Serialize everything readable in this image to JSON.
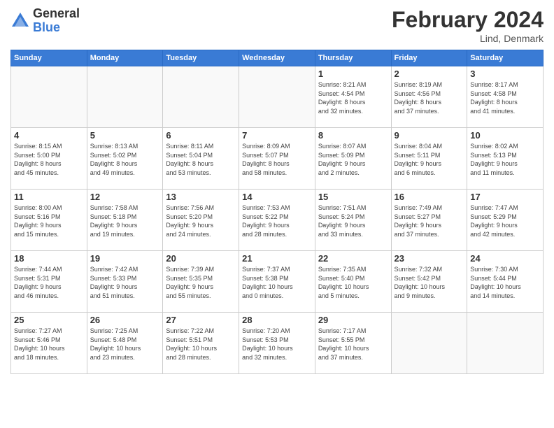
{
  "logo": {
    "general": "General",
    "blue": "Blue"
  },
  "header": {
    "title": "February 2024",
    "location": "Lind, Denmark"
  },
  "weekdays": [
    "Sunday",
    "Monday",
    "Tuesday",
    "Wednesday",
    "Thursday",
    "Friday",
    "Saturday"
  ],
  "weeks": [
    [
      {
        "day": "",
        "info": ""
      },
      {
        "day": "",
        "info": ""
      },
      {
        "day": "",
        "info": ""
      },
      {
        "day": "",
        "info": ""
      },
      {
        "day": "1",
        "info": "Sunrise: 8:21 AM\nSunset: 4:54 PM\nDaylight: 8 hours\nand 32 minutes."
      },
      {
        "day": "2",
        "info": "Sunrise: 8:19 AM\nSunset: 4:56 PM\nDaylight: 8 hours\nand 37 minutes."
      },
      {
        "day": "3",
        "info": "Sunrise: 8:17 AM\nSunset: 4:58 PM\nDaylight: 8 hours\nand 41 minutes."
      }
    ],
    [
      {
        "day": "4",
        "info": "Sunrise: 8:15 AM\nSunset: 5:00 PM\nDaylight: 8 hours\nand 45 minutes."
      },
      {
        "day": "5",
        "info": "Sunrise: 8:13 AM\nSunset: 5:02 PM\nDaylight: 8 hours\nand 49 minutes."
      },
      {
        "day": "6",
        "info": "Sunrise: 8:11 AM\nSunset: 5:04 PM\nDaylight: 8 hours\nand 53 minutes."
      },
      {
        "day": "7",
        "info": "Sunrise: 8:09 AM\nSunset: 5:07 PM\nDaylight: 8 hours\nand 58 minutes."
      },
      {
        "day": "8",
        "info": "Sunrise: 8:07 AM\nSunset: 5:09 PM\nDaylight: 9 hours\nand 2 minutes."
      },
      {
        "day": "9",
        "info": "Sunrise: 8:04 AM\nSunset: 5:11 PM\nDaylight: 9 hours\nand 6 minutes."
      },
      {
        "day": "10",
        "info": "Sunrise: 8:02 AM\nSunset: 5:13 PM\nDaylight: 9 hours\nand 11 minutes."
      }
    ],
    [
      {
        "day": "11",
        "info": "Sunrise: 8:00 AM\nSunset: 5:16 PM\nDaylight: 9 hours\nand 15 minutes."
      },
      {
        "day": "12",
        "info": "Sunrise: 7:58 AM\nSunset: 5:18 PM\nDaylight: 9 hours\nand 19 minutes."
      },
      {
        "day": "13",
        "info": "Sunrise: 7:56 AM\nSunset: 5:20 PM\nDaylight: 9 hours\nand 24 minutes."
      },
      {
        "day": "14",
        "info": "Sunrise: 7:53 AM\nSunset: 5:22 PM\nDaylight: 9 hours\nand 28 minutes."
      },
      {
        "day": "15",
        "info": "Sunrise: 7:51 AM\nSunset: 5:24 PM\nDaylight: 9 hours\nand 33 minutes."
      },
      {
        "day": "16",
        "info": "Sunrise: 7:49 AM\nSunset: 5:27 PM\nDaylight: 9 hours\nand 37 minutes."
      },
      {
        "day": "17",
        "info": "Sunrise: 7:47 AM\nSunset: 5:29 PM\nDaylight: 9 hours\nand 42 minutes."
      }
    ],
    [
      {
        "day": "18",
        "info": "Sunrise: 7:44 AM\nSunset: 5:31 PM\nDaylight: 9 hours\nand 46 minutes."
      },
      {
        "day": "19",
        "info": "Sunrise: 7:42 AM\nSunset: 5:33 PM\nDaylight: 9 hours\nand 51 minutes."
      },
      {
        "day": "20",
        "info": "Sunrise: 7:39 AM\nSunset: 5:35 PM\nDaylight: 9 hours\nand 55 minutes."
      },
      {
        "day": "21",
        "info": "Sunrise: 7:37 AM\nSunset: 5:38 PM\nDaylight: 10 hours\nand 0 minutes."
      },
      {
        "day": "22",
        "info": "Sunrise: 7:35 AM\nSunset: 5:40 PM\nDaylight: 10 hours\nand 5 minutes."
      },
      {
        "day": "23",
        "info": "Sunrise: 7:32 AM\nSunset: 5:42 PM\nDaylight: 10 hours\nand 9 minutes."
      },
      {
        "day": "24",
        "info": "Sunrise: 7:30 AM\nSunset: 5:44 PM\nDaylight: 10 hours\nand 14 minutes."
      }
    ],
    [
      {
        "day": "25",
        "info": "Sunrise: 7:27 AM\nSunset: 5:46 PM\nDaylight: 10 hours\nand 18 minutes."
      },
      {
        "day": "26",
        "info": "Sunrise: 7:25 AM\nSunset: 5:48 PM\nDaylight: 10 hours\nand 23 minutes."
      },
      {
        "day": "27",
        "info": "Sunrise: 7:22 AM\nSunset: 5:51 PM\nDaylight: 10 hours\nand 28 minutes."
      },
      {
        "day": "28",
        "info": "Sunrise: 7:20 AM\nSunset: 5:53 PM\nDaylight: 10 hours\nand 32 minutes."
      },
      {
        "day": "29",
        "info": "Sunrise: 7:17 AM\nSunset: 5:55 PM\nDaylight: 10 hours\nand 37 minutes."
      },
      {
        "day": "",
        "info": ""
      },
      {
        "day": "",
        "info": ""
      }
    ]
  ]
}
